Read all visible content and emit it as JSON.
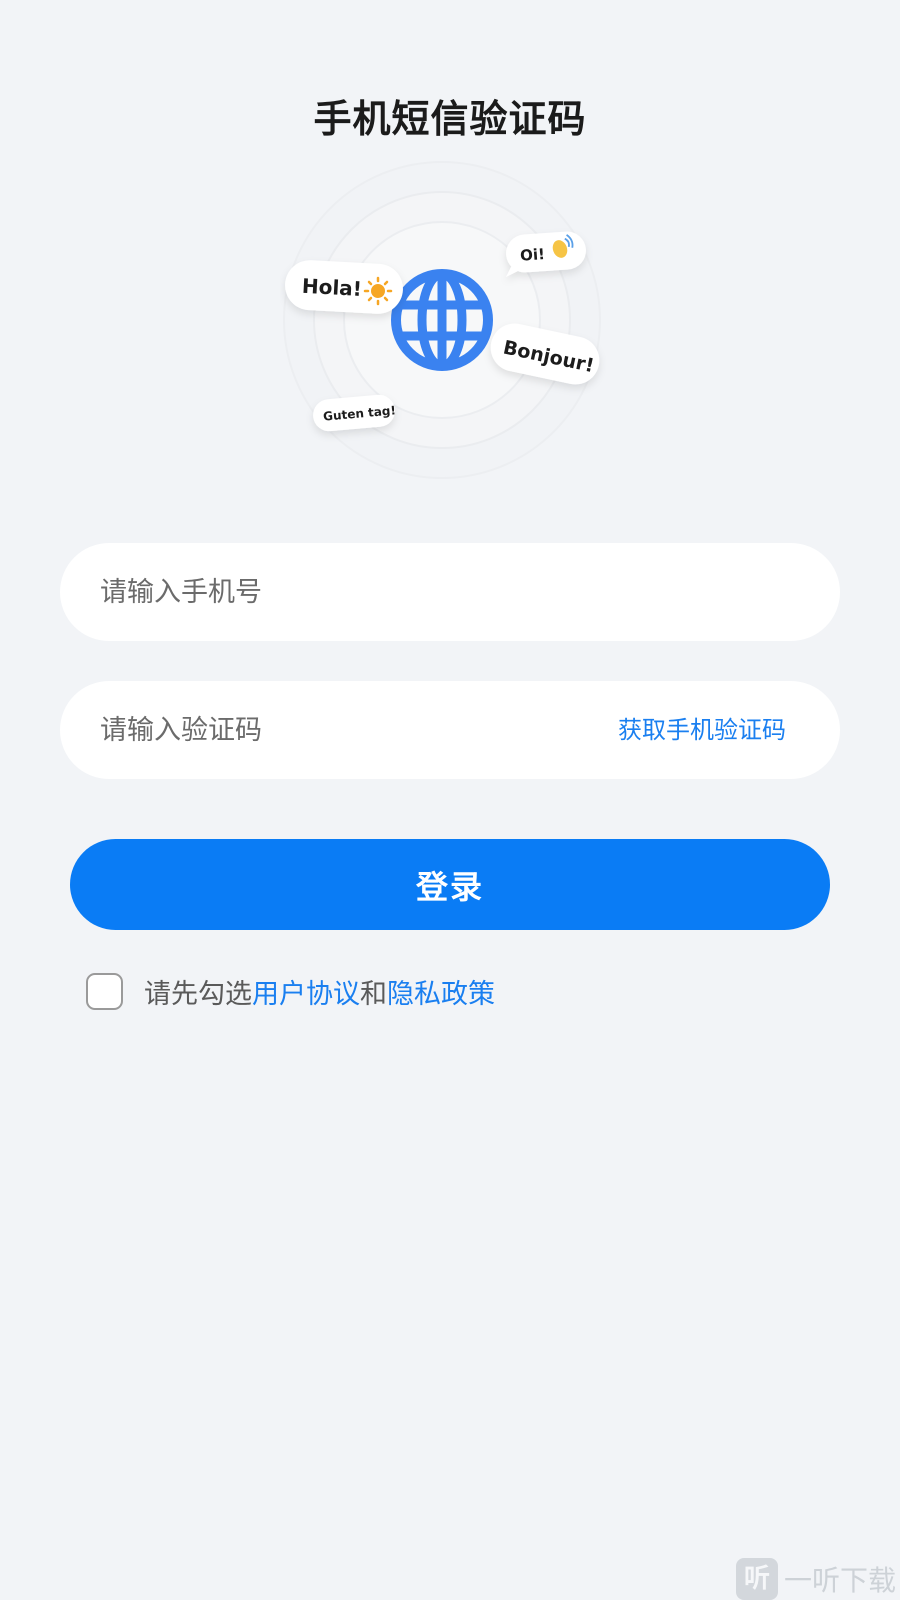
{
  "header": {
    "title": "手机短信验证码"
  },
  "illustration": {
    "bubbles": {
      "hola": "Hola!",
      "oi": "Oi!",
      "bonjour": "Bonjour!",
      "guten": "Guten tag!"
    },
    "colors": {
      "globe": "#3a82f0",
      "sun": "#f6a623"
    },
    "icons": [
      "globe-icon",
      "sun-icon",
      "waving-hand-icon"
    ]
  },
  "form": {
    "phone_placeholder": "请输入手机号",
    "code_placeholder": "请输入验证码",
    "get_code_label": "获取手机验证码",
    "login_label": "登录"
  },
  "agreement": {
    "prefix": "请先勾选",
    "user_agreement": "用户协议",
    "conjunction": "和",
    "privacy_policy": "隐私政策",
    "checked": false
  },
  "watermark": {
    "icon_char": "听",
    "text": "一听下载"
  },
  "colors": {
    "accent": "#0a7cf5",
    "link": "#1a7ff0",
    "background": "#f2f4f7"
  }
}
